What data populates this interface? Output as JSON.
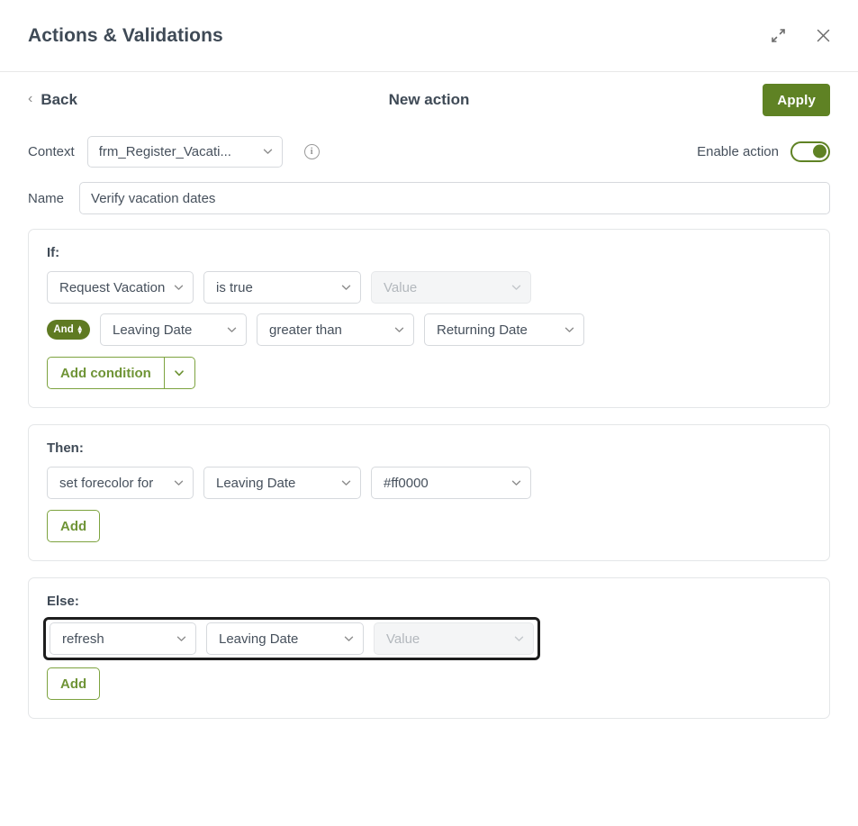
{
  "window": {
    "title": "Actions & Validations",
    "expand_icon": "expand-diagonal-icon",
    "close_icon": "close-icon"
  },
  "nav": {
    "back_label": "Back",
    "back_chevron": "‹",
    "page_title": "New action",
    "apply_label": "Apply"
  },
  "context": {
    "label": "Context",
    "value": "frm_Register_Vacati...",
    "info_glyph": "i",
    "enable_label": "Enable action",
    "enable_state": "on"
  },
  "name": {
    "label": "Name",
    "value": "Verify vacation dates",
    "placeholder": "Name"
  },
  "if_section": {
    "label": "If:",
    "conditions": [
      {
        "field": "Request Vacation",
        "operator": "is true",
        "value": "Value",
        "value_disabled": true,
        "connector": null
      },
      {
        "field": "Leaving Date",
        "operator": "greater than",
        "value": "Returning Date",
        "value_disabled": false,
        "connector": "And"
      }
    ],
    "add_label": "Add condition"
  },
  "then_section": {
    "label": "Then:",
    "actions": [
      {
        "operation": "set forecolor for",
        "target": "Leaving Date",
        "value": "#ff0000",
        "value_disabled": false
      }
    ],
    "add_label": "Add"
  },
  "else_section": {
    "label": "Else:",
    "actions": [
      {
        "operation": "refresh",
        "target": "Leaving Date",
        "value": "Value",
        "value_disabled": true,
        "focused": true
      }
    ],
    "add_label": "Add"
  },
  "colors": {
    "accent_green": "#5f8224",
    "badge_green": "#5f7a22",
    "outline_green": "#7da33f",
    "text_green": "#6f9436",
    "title_text": "#3f4a56",
    "border": "#d6d9dd",
    "card_border": "#e4e6e8",
    "focus_outline": "#1d1d1d",
    "forecolor_value": "#ff0000"
  }
}
